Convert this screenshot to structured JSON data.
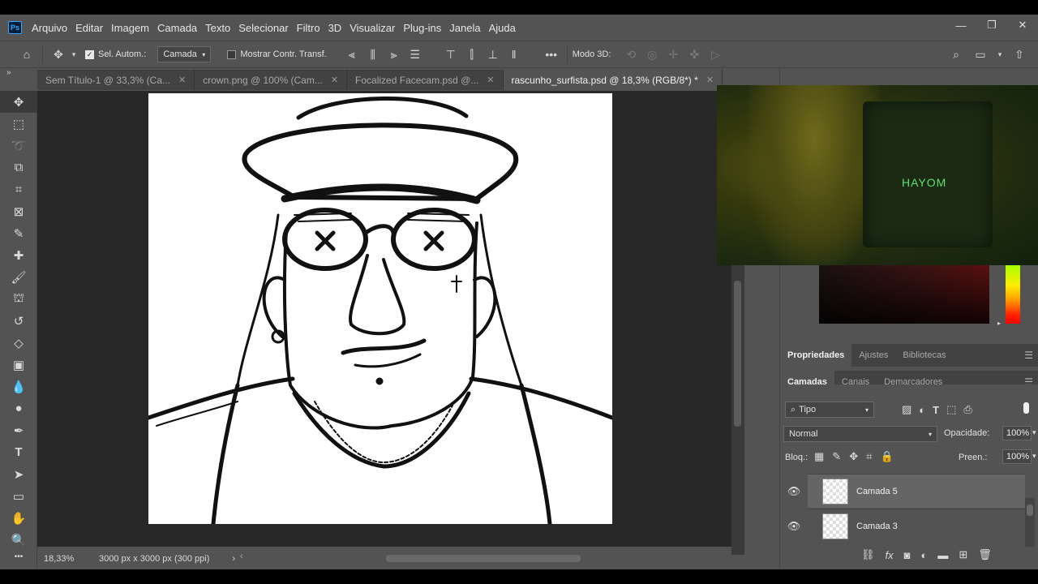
{
  "menu": {
    "logo": "Ps",
    "items": [
      "Arquivo",
      "Editar",
      "Imagem",
      "Camada",
      "Texto",
      "Selecionar",
      "Filtro",
      "3D",
      "Visualizar",
      "Plug-ins",
      "Janela",
      "Ajuda"
    ]
  },
  "window_controls": {
    "minimize": "—",
    "restore": "❐",
    "close": "✕"
  },
  "options": {
    "auto_select_label": "Sel. Autom.:",
    "auto_select_checked": true,
    "auto_select_target": "Camada",
    "show_transform_label": "Mostrar Contr. Transf.",
    "show_transform_checked": false,
    "mode_3d_label": "Modo 3D:",
    "more": "•••"
  },
  "tabs": [
    {
      "label": "Sem Título-1 @ 33,3% (Ca...",
      "active": false
    },
    {
      "label": "crown.png @ 100% (Cam...",
      "active": false
    },
    {
      "label": "Focalized Facecam.psd @...",
      "active": false
    },
    {
      "label": "rascunho_surfista.psd @ 18,3% (RGB/8*) *",
      "active": true
    }
  ],
  "status": {
    "zoom": "18,33%",
    "doc_info": "3000 px x 3000 px (300 ppi)"
  },
  "webcam": {
    "brand_text": "HAYOM"
  },
  "properties_tabs": [
    "Propriedades",
    "Ajustes",
    "Bibliotecas"
  ],
  "layers_tabs": [
    "Camadas",
    "Canais",
    "Demarcadores"
  ],
  "layers": {
    "filter_kind": "Tipo",
    "blend_mode": "Normal",
    "opacity_label": "Opacidade:",
    "opacity_value": "100%",
    "lock_label": "Bloq.:",
    "fill_label": "Preen.:",
    "fill_value": "100%",
    "items": [
      {
        "name": "Camada 5",
        "visible": true,
        "selected": true
      },
      {
        "name": "Camada 3",
        "visible": true,
        "selected": false
      }
    ]
  },
  "colors": {
    "app_bg": "#535353",
    "canvas_bg": "#282828",
    "accent_logo": "#31a8ff",
    "webcam_text": "#5ee06c"
  }
}
